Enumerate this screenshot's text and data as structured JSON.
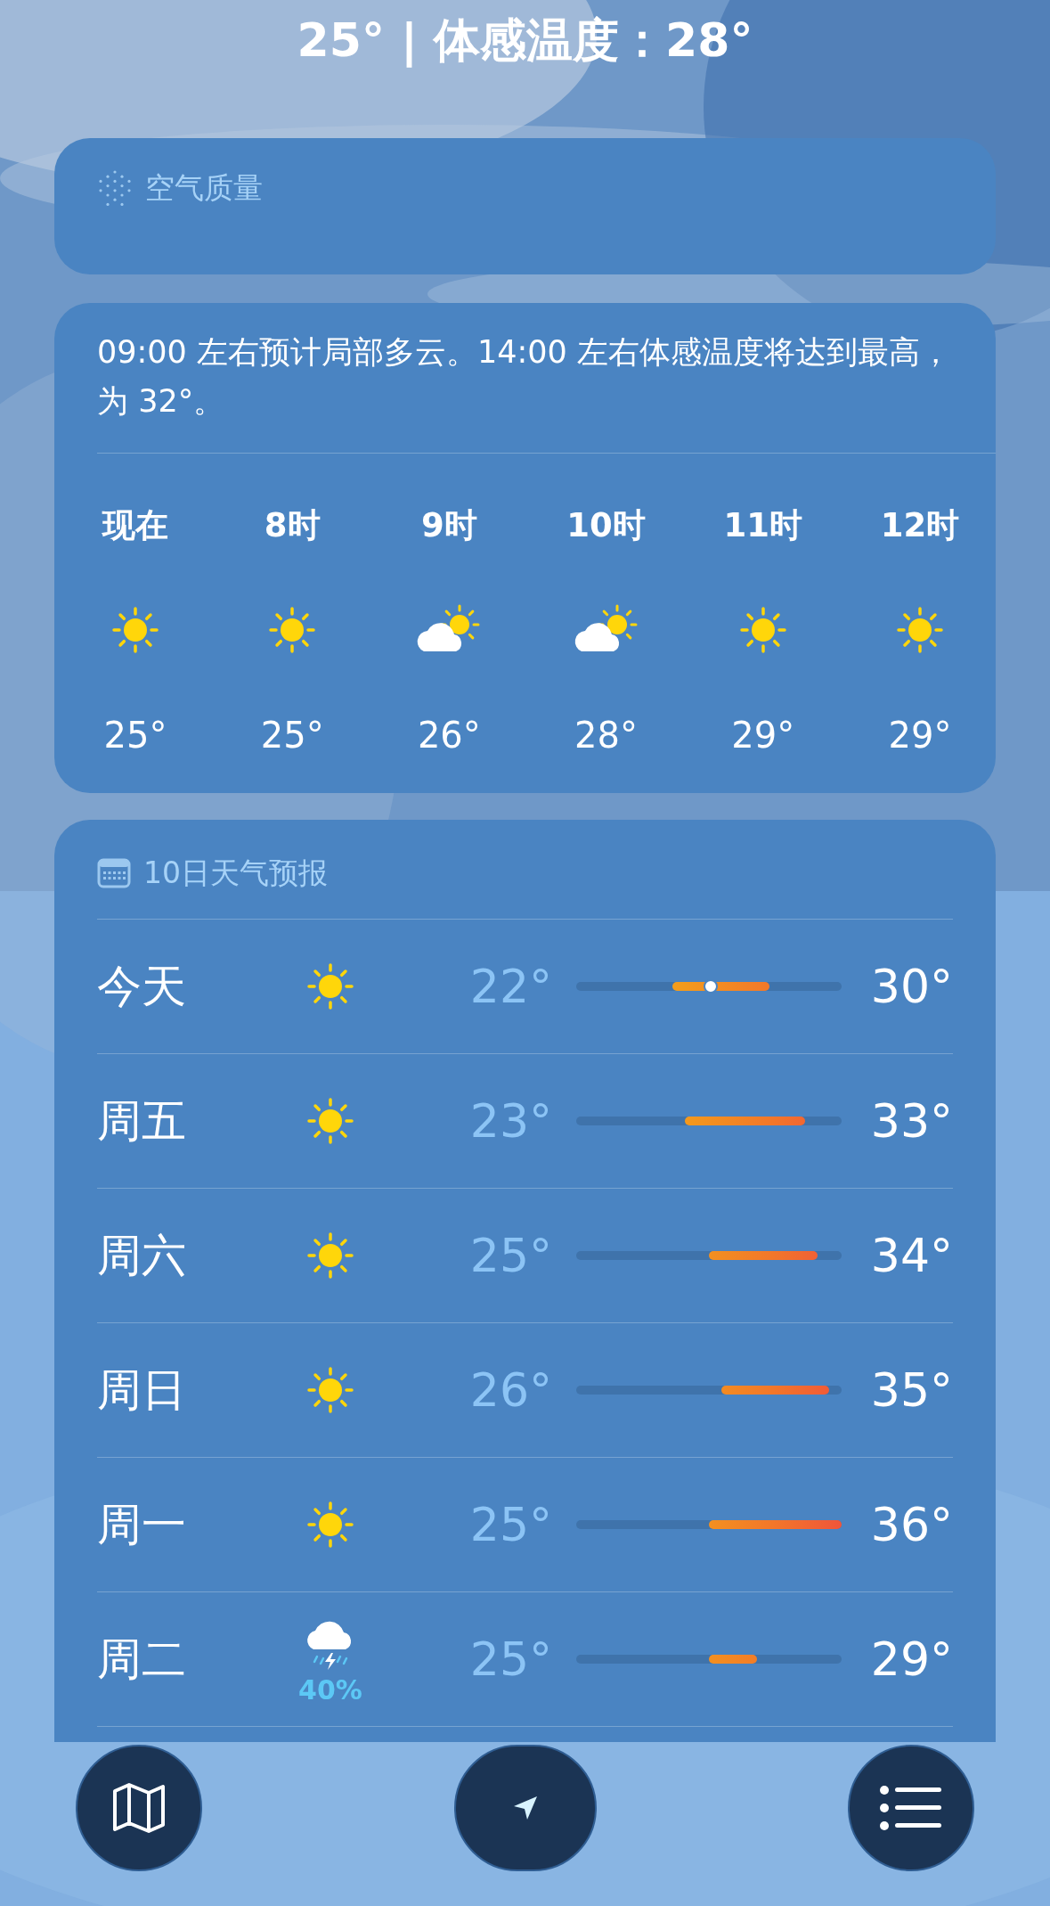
{
  "header": {
    "text": "25° | 体感温度：28°"
  },
  "air_quality": {
    "title": "空气质量"
  },
  "hourly": {
    "summary": "09:00 左右预计局部多云。14:00 左右体感温度将达到最高，为 32°。",
    "hours": [
      {
        "label": "现在",
        "kind": "sunny",
        "temp": "25°"
      },
      {
        "label": "8时",
        "kind": "sunny",
        "temp": "25°"
      },
      {
        "label": "9时",
        "kind": "partly_cloudy",
        "temp": "26°"
      },
      {
        "label": "10时",
        "kind": "partly_cloudy",
        "temp": "28°"
      },
      {
        "label": "11时",
        "kind": "sunny",
        "temp": "29°"
      },
      {
        "label": "12时",
        "kind": "sunny",
        "temp": "29°"
      }
    ]
  },
  "daily": {
    "title": "10日天气预报",
    "days": [
      {
        "day": "今天",
        "kind": "sunny",
        "low": "22°",
        "high": "30°"
      },
      {
        "day": "周五",
        "kind": "sunny",
        "low": "23°",
        "high": "33°"
      },
      {
        "day": "周六",
        "kind": "sunny",
        "low": "25°",
        "high": "34°"
      },
      {
        "day": "周日",
        "kind": "sunny",
        "low": "26°",
        "high": "35°"
      },
      {
        "day": "周一",
        "kind": "sunny",
        "low": "25°",
        "high": "36°"
      },
      {
        "day": "周二",
        "kind": "thunderstorm",
        "precipitation": "40%",
        "low": "25°",
        "high": "29°"
      }
    ]
  },
  "toolbar": {
    "buttons": [
      {
        "kind": "map"
      },
      {
        "kind": "location"
      },
      {
        "kind": "list"
      }
    ]
  }
}
